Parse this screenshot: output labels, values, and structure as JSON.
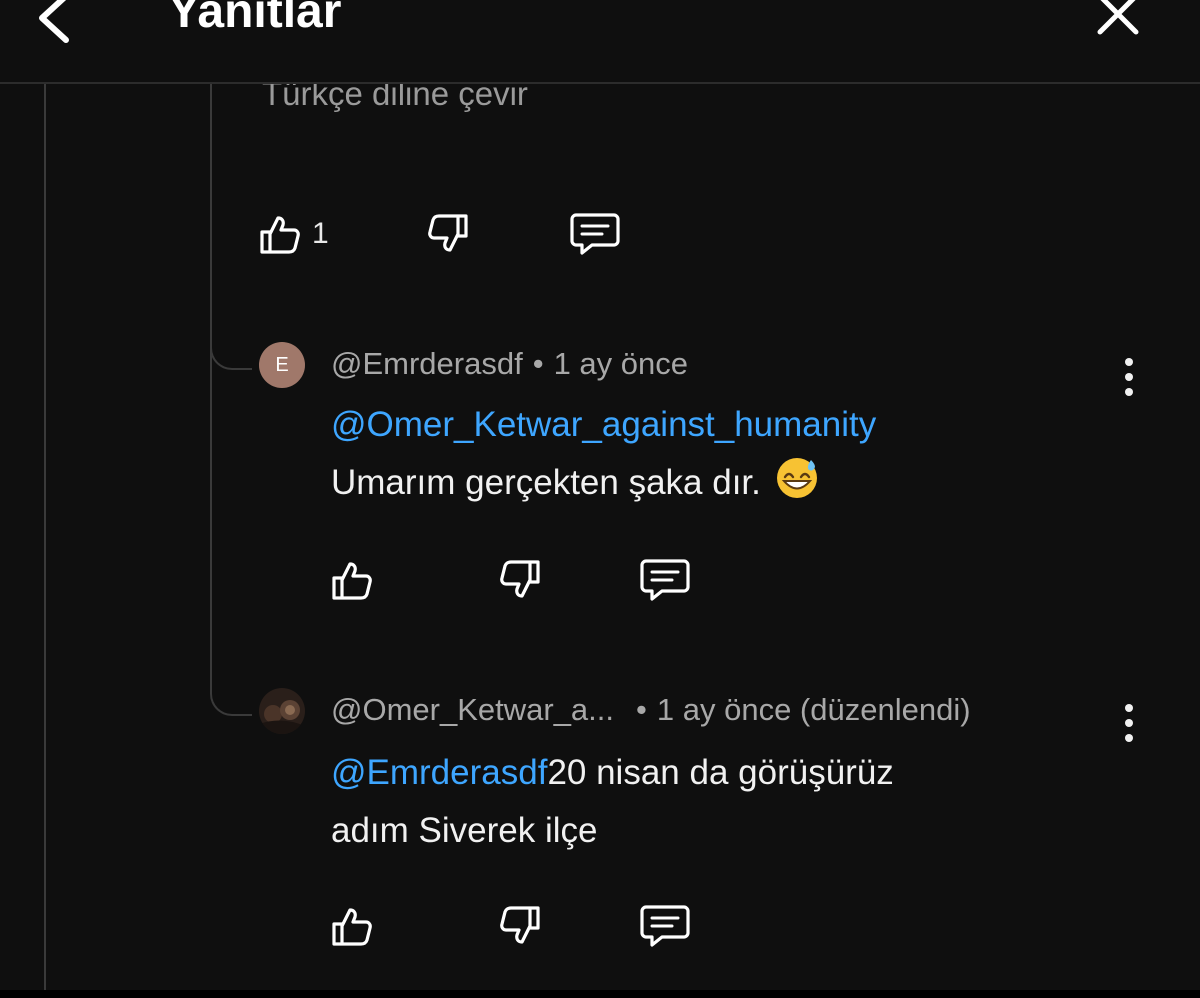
{
  "header": {
    "title": "Yanıtlar"
  },
  "translate_label": "Türkçe diline çevir",
  "parent_actions": {
    "like_count": "1"
  },
  "replies": [
    {
      "avatar_letter": "E",
      "author": "@Emrderasdf",
      "separator": "•",
      "time": "1 ay önce",
      "mention": "@Omer_Ketwar_against_humanity",
      "text": "Umarım gerçekten şaka dır.",
      "emoji": "grinning-sweat-emoji"
    },
    {
      "author": "@Omer_Ketwar_a...",
      "separator": "•",
      "time": "1 ay önce (düzenlendi)",
      "mention": "@Emrderasdf",
      "text_line1": "20 nisan da görüşürüz",
      "text_line2": "adım Siverek ilçe"
    }
  ],
  "colors": {
    "background": "#0f0f0f",
    "text": "#f1f1f1",
    "secondary_text": "#a8a8a8",
    "mention": "#3ea6ff",
    "avatar_e": "#a0786a"
  }
}
